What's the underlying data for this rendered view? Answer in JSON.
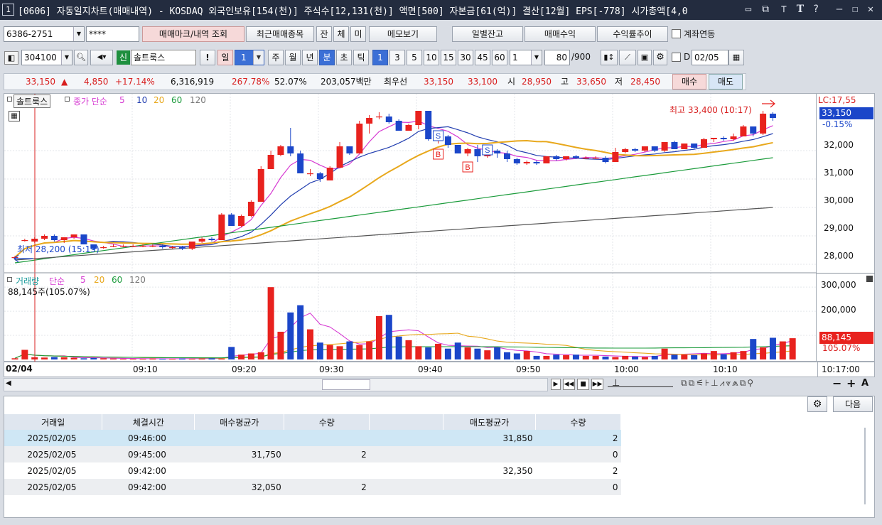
{
  "titlebar": {
    "num": "1",
    "text": "[0606] 자동일지차트(매매내역) - KOSDAQ 외국인보유[154(천)] 주식수[12,131(천)] 액면[500] 자본금[61(억)] 결산[12월] EPS[-778] 시가총액[4,0"
  },
  "toolbar1": {
    "account": "6386-2751",
    "password": "****",
    "trade_mark_btn": "매매마크/내역 조회",
    "recent_btn": "최근매매종목",
    "btn_jan": "잔",
    "btn_che": "체",
    "btn_mi": "미",
    "memo_btn": "메모보기",
    "daily_btn": "일별잔고",
    "profit_btn": "매매수익",
    "return_btn": "수익률추이",
    "link_label": "계좌연동"
  },
  "toolbar2": {
    "code": "304100",
    "badge": "신",
    "name": "솔트룩스",
    "excl": "!",
    "periods": [
      "일",
      "1",
      "주",
      "월",
      "년",
      "분",
      "초",
      "틱"
    ],
    "minutes": [
      "1",
      "3",
      "5",
      "10",
      "15",
      "30",
      "45",
      "60"
    ],
    "count": "1",
    "view": "80",
    "total": "/900",
    "d_label": "D",
    "date": "02/05"
  },
  "quote": {
    "price": "33,150",
    "arrow": "▲",
    "change": "4,850",
    "pct": "+17.14%",
    "volume": "6,316,919",
    "vol_ratio": "267.78%",
    "turnover": "52.07%",
    "amount": "203,057백만",
    "best_label": "최우선",
    "ask": "33,150",
    "bid": "33,100",
    "open_label": "시",
    "open": "28,950",
    "high_label": "고",
    "high": "33,650",
    "low_label": "저",
    "low": "28,450",
    "buy": "매수",
    "sell": "매도"
  },
  "chart_data": [
    {
      "type": "candlestick",
      "series_name": "솔트룩스",
      "legend": {
        "label": "종가 단순",
        "periods": [
          "5",
          "10",
          "20",
          "60",
          "120"
        ]
      },
      "annotations": {
        "high": "최고 33,400 (10:17)",
        "low": "최저 28,200 (15:19)",
        "lc": "LC:17,55",
        "last_price": "33,150",
        "last_pct": "-0.15%",
        "marks": [
          "S",
          "B",
          "S",
          "B"
        ]
      },
      "y_ticks": [
        "32,000",
        "31,000",
        "30,000",
        "29,000",
        "28,000"
      ],
      "ylim": [
        27800,
        33800
      ],
      "x_ticks": [
        "02/04",
        "09:10",
        "09:20",
        "09:30",
        "09:40",
        "09:50",
        "10:00",
        "10:10"
      ],
      "x_current": "10:17:00",
      "ohlc": [
        [
          28250,
          28300,
          28150,
          28250
        ],
        [
          28850,
          28900,
          28800,
          28850
        ],
        [
          28800,
          28950,
          28750,
          28900
        ],
        [
          28900,
          29050,
          28850,
          29000
        ],
        [
          29000,
          29050,
          28800,
          28850
        ],
        [
          28850,
          28950,
          28750,
          28950
        ],
        [
          28950,
          29050,
          28900,
          29050
        ],
        [
          29050,
          29050,
          28700,
          28700
        ],
        [
          28700,
          28700,
          28500,
          28550
        ],
        [
          28600,
          28650,
          28550,
          28600
        ],
        [
          28650,
          28700,
          28600,
          28650
        ],
        [
          28650,
          28700,
          28600,
          28650
        ],
        [
          28650,
          28700,
          28600,
          28650
        ],
        [
          28650,
          28700,
          28600,
          28650
        ],
        [
          28650,
          28700,
          28600,
          28650
        ],
        [
          28650,
          28700,
          28550,
          28600
        ],
        [
          28600,
          28650,
          28550,
          28600
        ],
        [
          28600,
          28650,
          28500,
          28550
        ],
        [
          28550,
          28800,
          28500,
          28800
        ],
        [
          28800,
          28950,
          28750,
          28900
        ],
        [
          28900,
          28950,
          28800,
          28850
        ],
        [
          28850,
          29800,
          28850,
          29750
        ],
        [
          29750,
          29800,
          29350,
          29350
        ],
        [
          29350,
          29750,
          29300,
          29700
        ],
        [
          29700,
          30250,
          29650,
          30200
        ],
        [
          30200,
          31450,
          30200,
          31350
        ],
        [
          31350,
          32000,
          31350,
          31850
        ],
        [
          31850,
          32200,
          31800,
          32150
        ],
        [
          32150,
          32800,
          31800,
          31900
        ],
        [
          31900,
          32000,
          31200,
          31200
        ],
        [
          31200,
          31350,
          31100,
          31200
        ],
        [
          31200,
          31250,
          30900,
          31000
        ],
        [
          30950,
          31450,
          30950,
          31400
        ],
        [
          31400,
          32300,
          31400,
          32150
        ],
        [
          32150,
          32150,
          31850,
          31900
        ],
        [
          31900,
          33050,
          31900,
          32950
        ],
        [
          32950,
          33250,
          32600,
          33150
        ],
        [
          33200,
          33350,
          33100,
          33200
        ],
        [
          33200,
          33300,
          32950,
          33000
        ],
        [
          33050,
          33100,
          32700,
          32700
        ],
        [
          32700,
          32950,
          32700,
          32900
        ],
        [
          32900,
          33400,
          32750,
          33400
        ],
        [
          33400,
          33400,
          32350,
          32400
        ],
        [
          32400,
          32650,
          32250,
          32500
        ],
        [
          32500,
          32550,
          32100,
          32200
        ],
        [
          32200,
          32200,
          31900,
          31900
        ],
        [
          31900,
          32100,
          31800,
          32050
        ],
        [
          32050,
          32200,
          31600,
          31800
        ],
        [
          31800,
          32150,
          31750,
          32050
        ],
        [
          32000,
          32050,
          31750,
          31900
        ],
        [
          31900,
          32000,
          31600,
          31700
        ],
        [
          31700,
          31750,
          31500,
          31550
        ],
        [
          31550,
          31650,
          31500,
          31600
        ],
        [
          31600,
          31650,
          31500,
          31550
        ],
        [
          31550,
          31800,
          31550,
          31800
        ],
        [
          31800,
          31850,
          31650,
          31700
        ],
        [
          31700,
          31800,
          31650,
          31800
        ],
        [
          31800,
          31850,
          31700,
          31750
        ],
        [
          31750,
          31800,
          31700,
          31750
        ],
        [
          31750,
          31800,
          31700,
          31750
        ],
        [
          31750,
          31800,
          31550,
          31600
        ],
        [
          31600,
          32100,
          31600,
          31950
        ],
        [
          31950,
          32100,
          31900,
          32050
        ],
        [
          32050,
          32100,
          31950,
          32000
        ],
        [
          32000,
          32150,
          31950,
          32150
        ],
        [
          32150,
          32150,
          31950,
          32000
        ],
        [
          32000,
          32300,
          31950,
          32300
        ],
        [
          32300,
          32350,
          32050,
          32050
        ],
        [
          32050,
          32250,
          32050,
          32250
        ],
        [
          32250,
          32200,
          32050,
          32100
        ],
        [
          32100,
          32450,
          32100,
          32400
        ],
        [
          32400,
          32450,
          32300,
          32450
        ],
        [
          32450,
          32500,
          32350,
          32400
        ],
        [
          32400,
          32600,
          32350,
          32500
        ],
        [
          32500,
          32900,
          32500,
          32850
        ],
        [
          32850,
          32800,
          32500,
          32600
        ],
        [
          32600,
          33400,
          32550,
          33300
        ],
        [
          33300,
          33350,
          33050,
          33150
        ]
      ]
    },
    {
      "type": "bar",
      "series_name": "거래량",
      "legend": {
        "label": "단순",
        "periods": [
          "5",
          "20",
          "60",
          "120"
        ]
      },
      "annotations": {
        "last_volume": "88,145주(105.07%)",
        "last_value": "88,145",
        "last_pct": "105.07%"
      },
      "y_ticks": [
        "300,000",
        "200,000"
      ],
      "ylim": [
        0,
        330000
      ],
      "values": [
        5000,
        40000,
        9000,
        8000,
        10000,
        9000,
        7000,
        5000,
        6000,
        5000,
        4000,
        3000,
        3000,
        3000,
        4000,
        3000,
        3000,
        4000,
        3000,
        4000,
        5000,
        4000,
        52000,
        20000,
        25000,
        30000,
        300000,
        115000,
        195000,
        225000,
        125000,
        70000,
        60000,
        55000,
        75000,
        60000,
        75000,
        180000,
        185000,
        95000,
        80000,
        55000,
        50000,
        65000,
        45000,
        70000,
        50000,
        45000,
        38000,
        50000,
        30000,
        25000,
        35000,
        15000,
        15000,
        20000,
        18000,
        20000,
        15000,
        15000,
        12000,
        10000,
        15000,
        12000,
        10000,
        15000,
        45000,
        20000,
        20000,
        18000,
        25000,
        35000,
        22000,
        30000,
        35000,
        85000,
        50000,
        90000,
        75000,
        88145
      ]
    }
  ],
  "hscroll": {
    "left": "◀"
  },
  "grid": {
    "settings_icon": "gear-icon",
    "next_btn": "다음",
    "columns": [
      "거래일",
      "체결시간",
      "매수평균가",
      "수량",
      "",
      "매도평균가",
      "수량"
    ],
    "rows": [
      [
        "2025/02/05",
        "09:46:00",
        "",
        "",
        "",
        "31,850",
        "2"
      ],
      [
        "2025/02/05",
        "09:45:00",
        "31,750",
        "2",
        "",
        "",
        "0"
      ],
      [
        "2025/02/05",
        "09:42:00",
        "",
        "",
        "",
        "32,350",
        "2"
      ],
      [
        "2025/02/05",
        "09:42:00",
        "32,050",
        "2",
        "",
        "",
        "0"
      ]
    ]
  },
  "colors": {
    "up": "#e8221e",
    "down": "#1b46c9",
    "ma5": "#d63ad2",
    "ma10": "#233fb0",
    "ma20": "#e8a81c",
    "ma60": "#1b9b3b",
    "ma120": "#555555",
    "accent": "#3b6fd6"
  }
}
